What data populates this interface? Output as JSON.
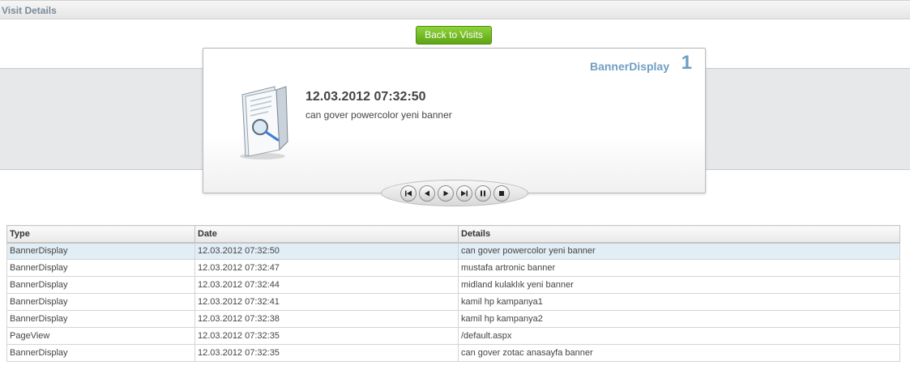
{
  "panel": {
    "title": "Visit Details"
  },
  "actions": {
    "back_label": "Back to Visits"
  },
  "card": {
    "type": "BannerDisplay",
    "index": "1",
    "date": "12.03.2012 07:32:50",
    "details": "can gover powercolor yeni banner",
    "icon": "document-search-icon"
  },
  "player": {
    "buttons": [
      {
        "name": "first-button",
        "icon": "skip-first-icon"
      },
      {
        "name": "previous-button",
        "icon": "previous-icon"
      },
      {
        "name": "play-button",
        "icon": "play-icon"
      },
      {
        "name": "next-button",
        "icon": "skip-next-icon"
      },
      {
        "name": "pause-button",
        "icon": "pause-icon"
      },
      {
        "name": "stop-button",
        "icon": "stop-icon"
      }
    ]
  },
  "table": {
    "columns": [
      "Type",
      "Date",
      "Details"
    ],
    "rows": [
      [
        "BannerDisplay",
        "12.03.2012 07:32:50",
        "can gover powercolor yeni banner"
      ],
      [
        "BannerDisplay",
        "12.03.2012 07:32:47",
        "mustafa artronic banner"
      ],
      [
        "BannerDisplay",
        "12.03.2012 07:32:44",
        "midland kulaklık yeni banner"
      ],
      [
        "BannerDisplay",
        "12.03.2012 07:32:41",
        "kamil hp kampanya1"
      ],
      [
        "BannerDisplay",
        "12.03.2012 07:32:38",
        "kamil hp kampanya2"
      ],
      [
        "PageView",
        "12.03.2012 07:32:35",
        "/default.aspx"
      ],
      [
        "BannerDisplay",
        "12.03.2012 07:32:35",
        "can gover zotac anasayfa banner"
      ]
    ],
    "selected_row": 0
  }
}
